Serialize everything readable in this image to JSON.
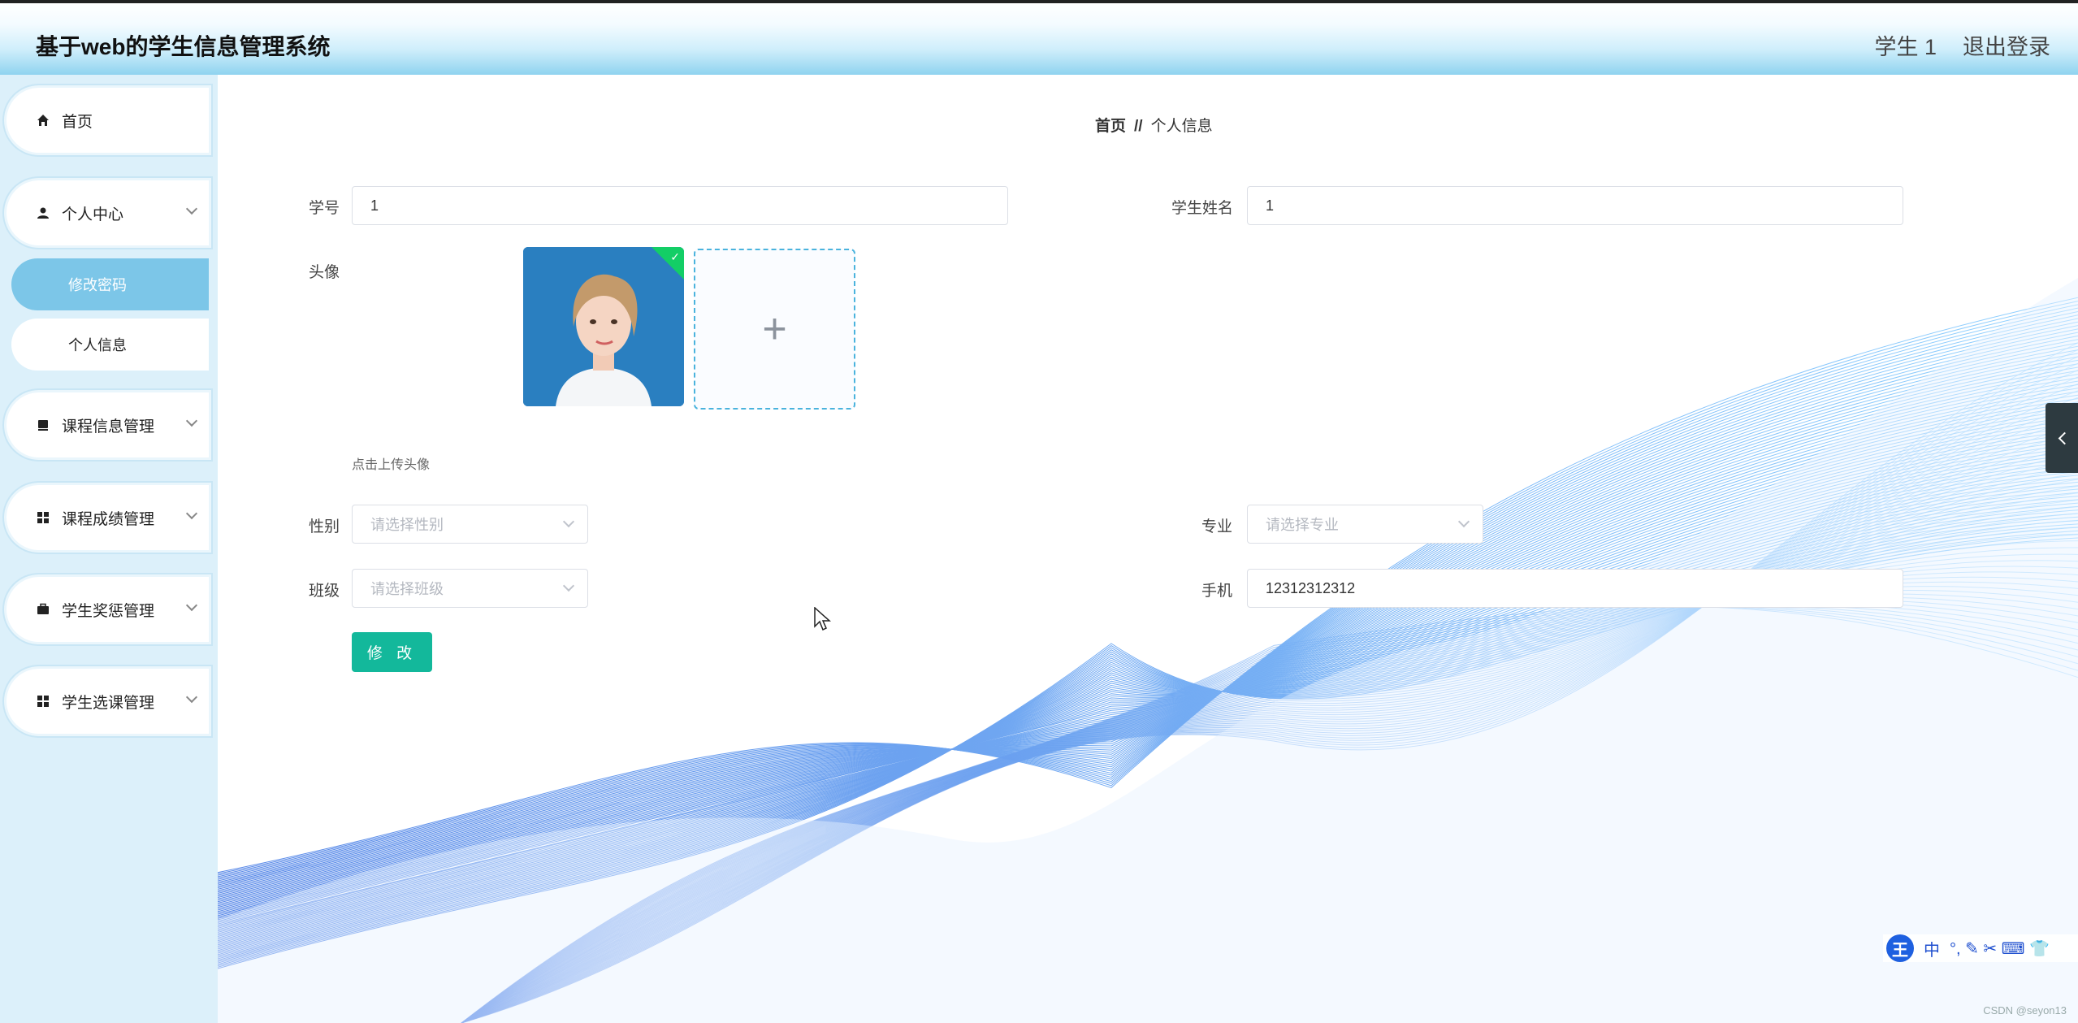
{
  "app": {
    "title": "基于web的学生信息管理系统"
  },
  "header": {
    "user": "学生 1",
    "logout": "退出登录"
  },
  "sidebar": {
    "items": [
      {
        "label": "首页",
        "icon": "home-icon"
      },
      {
        "label": "个人中心",
        "icon": "user-icon"
      },
      {
        "label": "修改密码",
        "active": true
      },
      {
        "label": "个人信息"
      },
      {
        "label": "课程信息管理",
        "icon": "book-icon"
      },
      {
        "label": "课程成绩管理",
        "icon": "grid-icon"
      },
      {
        "label": "学生奖惩管理",
        "icon": "briefcase-icon"
      },
      {
        "label": "学生选课管理",
        "icon": "grid-icon"
      }
    ]
  },
  "breadcrumb": {
    "home": "首页",
    "separator": "//",
    "current": "个人信息"
  },
  "form": {
    "student_no": {
      "label": "学号",
      "value": "1"
    },
    "student_name": {
      "label": "学生姓名",
      "value": "1"
    },
    "avatar": {
      "label": "头像",
      "hint": "点击上传头像"
    },
    "gender": {
      "label": "性别",
      "placeholder": "请选择性别"
    },
    "major": {
      "label": "专业",
      "placeholder": "请选择专业"
    },
    "class": {
      "label": "班级",
      "placeholder": "请选择班级"
    },
    "phone": {
      "label": "手机",
      "value": "12312312312"
    },
    "submit": "修 改"
  },
  "ime": {
    "logo": "王",
    "mode": "中",
    "tools": "°, ✎ ✂ ⌨ 👕"
  },
  "watermark": "CSDN @seyon13",
  "colors": {
    "accent": "#13b89b",
    "sidebar": "#dcf0fa",
    "active": "#7cc6e8",
    "wave": "#1e7ae6"
  }
}
